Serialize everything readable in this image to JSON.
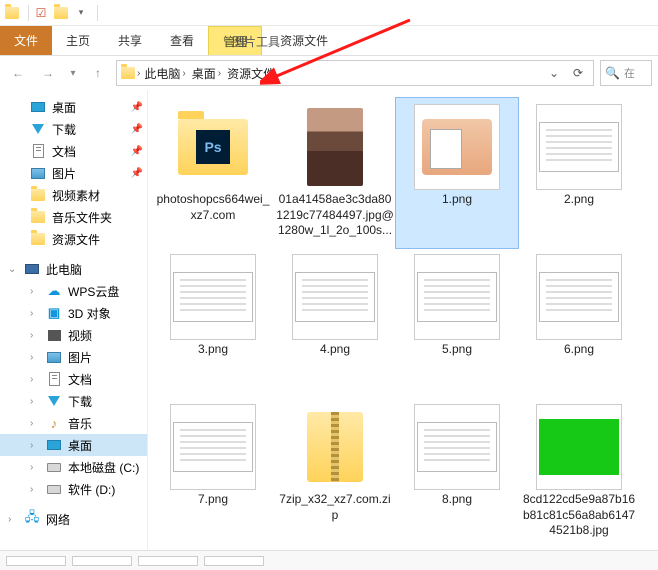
{
  "window": {
    "title": "资源文件"
  },
  "ribbon": {
    "file": "文件",
    "tabs": [
      "主页",
      "共享",
      "查看"
    ],
    "context_head": "管理",
    "context_tool": "图片工具",
    "context_title": "资源文件"
  },
  "breadcrumb": {
    "items": [
      "此电脑",
      "桌面",
      "资源文件"
    ]
  },
  "search": {
    "placeholder": "在"
  },
  "sidebar": {
    "quick": [
      {
        "label": "桌面",
        "icon": "desktop",
        "pinned": true
      },
      {
        "label": "下载",
        "icon": "download",
        "pinned": true
      },
      {
        "label": "文档",
        "icon": "doc",
        "pinned": true
      },
      {
        "label": "图片",
        "icon": "pic",
        "pinned": true
      },
      {
        "label": "视频素材",
        "icon": "folder",
        "pinned": false
      },
      {
        "label": "音乐文件夹",
        "icon": "folder",
        "pinned": false
      },
      {
        "label": "资源文件",
        "icon": "folder",
        "pinned": false
      }
    ],
    "pc_label": "此电脑",
    "pc_items": [
      {
        "label": "WPS云盘",
        "icon": "cloud"
      },
      {
        "label": "3D 对象",
        "icon": "3d"
      },
      {
        "label": "视频",
        "icon": "video"
      },
      {
        "label": "图片",
        "icon": "pic"
      },
      {
        "label": "文档",
        "icon": "doc"
      },
      {
        "label": "下载",
        "icon": "download"
      },
      {
        "label": "音乐",
        "icon": "music"
      },
      {
        "label": "桌面",
        "icon": "desktop",
        "selected": true
      },
      {
        "label": "本地磁盘 (C:)",
        "icon": "drive"
      },
      {
        "label": "软件 (D:)",
        "icon": "drive"
      }
    ],
    "network_label": "网络"
  },
  "files": [
    {
      "name": "photoshopcs664wei_xz7.com",
      "type": "folder-ps"
    },
    {
      "name": "01a41458ae3c3da801219c77484497.jpg@1280w_1l_2o_100s...",
      "type": "woman"
    },
    {
      "name": "1.png",
      "type": "cat",
      "selected": true
    },
    {
      "name": "2.png",
      "type": "screenshot"
    },
    {
      "name": "3.png",
      "type": "screenshot"
    },
    {
      "name": "4.png",
      "type": "screenshot"
    },
    {
      "name": "5.png",
      "type": "screenshot"
    },
    {
      "name": "6.png",
      "type": "screenshot"
    },
    {
      "name": "7.png",
      "type": "screenshot"
    },
    {
      "name": "7zip_x32_xz7.com.zip",
      "type": "zip"
    },
    {
      "name": "8.png",
      "type": "screenshot"
    },
    {
      "name": "8cd122cd5e9a87b16b81c81c56a8ab61474521b8.jpg",
      "type": "green"
    }
  ]
}
